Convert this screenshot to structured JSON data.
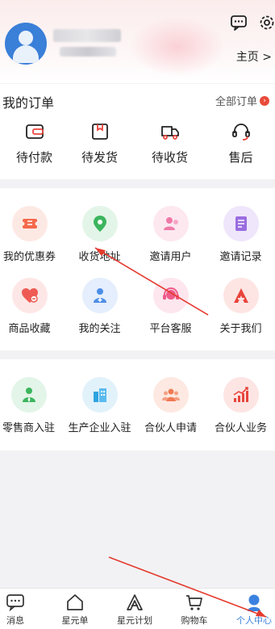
{
  "header": {
    "homepage_label": "主页 >"
  },
  "orders": {
    "title": "我的订单",
    "all_label": "全部订单",
    "all_badge": "›",
    "items": [
      {
        "label": "待付款",
        "icon": "wallet-icon"
      },
      {
        "label": "待发货",
        "icon": "gift-box-icon"
      },
      {
        "label": "待收货",
        "icon": "delivery-truck-icon"
      },
      {
        "label": "售后",
        "icon": "headset-icon"
      }
    ]
  },
  "services": {
    "items": [
      {
        "label": "我的优惠券",
        "icon": "coupon-icon",
        "color": "#f4694a",
        "bg": "#fde9e4"
      },
      {
        "label": "收货地址",
        "icon": "location-pin-icon",
        "color": "#3cb55e",
        "bg": "#e3f5e8"
      },
      {
        "label": "邀请用户",
        "icon": "invite-users-icon",
        "color": "#ef7aa8",
        "bg": "#fde8f0"
      },
      {
        "label": "邀请记录",
        "icon": "record-list-icon",
        "color": "#9a6de0",
        "bg": "#efe6fb"
      },
      {
        "label": "商品收藏",
        "icon": "heart-favorite-icon",
        "color": "#ee5b54",
        "bg": "#fde7e6"
      },
      {
        "label": "我的关注",
        "icon": "follow-user-icon",
        "color": "#4c8ee6",
        "bg": "#e4eefc"
      },
      {
        "label": "平台客服",
        "icon": "customer-service-icon",
        "color": "#ee5b8a",
        "bg": "#fde6ee"
      },
      {
        "label": "关于我们",
        "icon": "about-us-icon",
        "color": "#e8453c",
        "bg": "#fde5e4"
      }
    ]
  },
  "partners": {
    "items": [
      {
        "label": "零售商入驻",
        "icon": "retailer-icon",
        "color": "#3cb55e",
        "bg": "#e3f5e8"
      },
      {
        "label": "生产企业入驻",
        "icon": "factory-icon",
        "color": "#2fa4e0",
        "bg": "#e2f2fb"
      },
      {
        "label": "合伙人申请",
        "icon": "partner-group-icon",
        "color": "#f07a52",
        "bg": "#fde9e2"
      },
      {
        "label": "合伙人业务",
        "icon": "growth-chart-icon",
        "color": "#e8453c",
        "bg": "#fde5e4"
      }
    ]
  },
  "tabbar": {
    "active_color": "#3b82e0",
    "items": [
      {
        "label": "消息",
        "icon": "message-icon"
      },
      {
        "label": "星元单",
        "icon": "home-icon"
      },
      {
        "label": "星元计划",
        "icon": "plan-a-icon"
      },
      {
        "label": "购物车",
        "icon": "cart-icon"
      },
      {
        "label": "个人中心",
        "icon": "user-profile-icon",
        "active": true
      }
    ]
  }
}
